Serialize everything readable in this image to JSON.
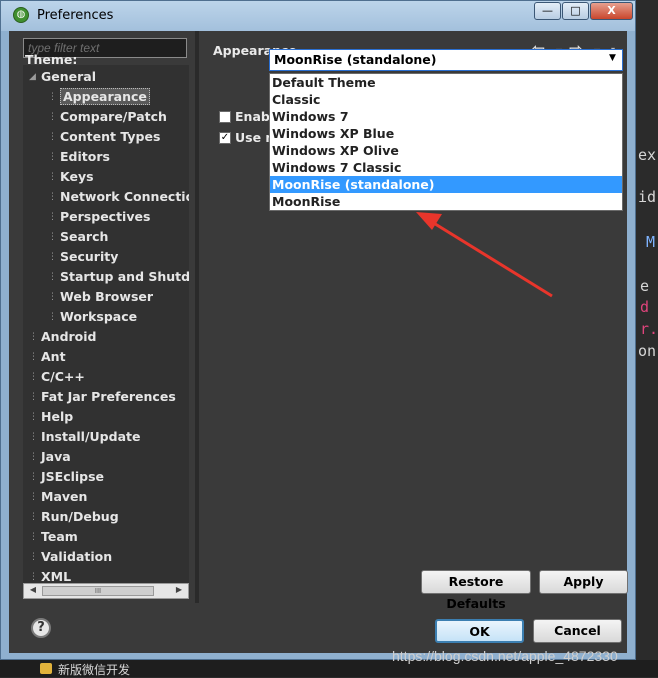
{
  "window": {
    "title": "Preferences",
    "controls": {
      "minimize": "—",
      "maximize": "□",
      "close": "X"
    }
  },
  "filter": {
    "placeholder": "type filter text"
  },
  "tree": {
    "items": [
      {
        "label": "General",
        "level": 0,
        "expanded": true
      },
      {
        "label": "Appearance",
        "level": 1,
        "selected": true
      },
      {
        "label": "Compare/Patch",
        "level": 1
      },
      {
        "label": "Content Types",
        "level": 1
      },
      {
        "label": "Editors",
        "level": 1
      },
      {
        "label": "Keys",
        "level": 1
      },
      {
        "label": "Network Connection",
        "level": 1
      },
      {
        "label": "Perspectives",
        "level": 1
      },
      {
        "label": "Search",
        "level": 1
      },
      {
        "label": "Security",
        "level": 1
      },
      {
        "label": "Startup and Shutdown",
        "level": 1
      },
      {
        "label": "Web Browser",
        "level": 1
      },
      {
        "label": "Workspace",
        "level": 1
      },
      {
        "label": "Android",
        "level": 0
      },
      {
        "label": "Ant",
        "level": 0
      },
      {
        "label": "C/C++",
        "level": 0
      },
      {
        "label": "Fat Jar Preferences",
        "level": 0
      },
      {
        "label": "Help",
        "level": 0
      },
      {
        "label": "Install/Update",
        "level": 0
      },
      {
        "label": "Java",
        "level": 0
      },
      {
        "label": "JSEclipse",
        "level": 0
      },
      {
        "label": "Maven",
        "level": 0
      },
      {
        "label": "Run/Debug",
        "level": 0
      },
      {
        "label": "Team",
        "level": 0
      },
      {
        "label": "Validation",
        "level": 0
      },
      {
        "label": "XML",
        "level": 0
      }
    ],
    "scroll_thumb": "III"
  },
  "page": {
    "title": "Appearance",
    "theme_label": "Theme:",
    "theme_value": "MoonRise (standalone)",
    "checkbox1": {
      "label": "Enabl",
      "checked": false
    },
    "checkbox2": {
      "label": "Use m",
      "checked": true
    },
    "theme_options": [
      "Default Theme",
      "Classic",
      "Windows 7",
      "Windows XP Blue",
      "Windows XP Olive",
      "Windows 7 Classic",
      "MoonRise (standalone)",
      "MoonRise"
    ],
    "selected_option_index": 6
  },
  "buttons": {
    "restore_defaults": "Restore Defaults",
    "apply": "Apply",
    "ok": "OK",
    "cancel": "Cancel"
  },
  "background": {
    "fragments": [
      "ex",
      "id",
      "M",
      "e",
      "d",
      "r.",
      "on"
    ],
    "taskbar_text": "新版微信开发"
  },
  "watermark": "https://blog.csdn.net/apple_4872330",
  "colors": {
    "selection": "#3399ff",
    "annotation_arrow": "#e8352b",
    "dark_bg": "#3a3a3a"
  }
}
